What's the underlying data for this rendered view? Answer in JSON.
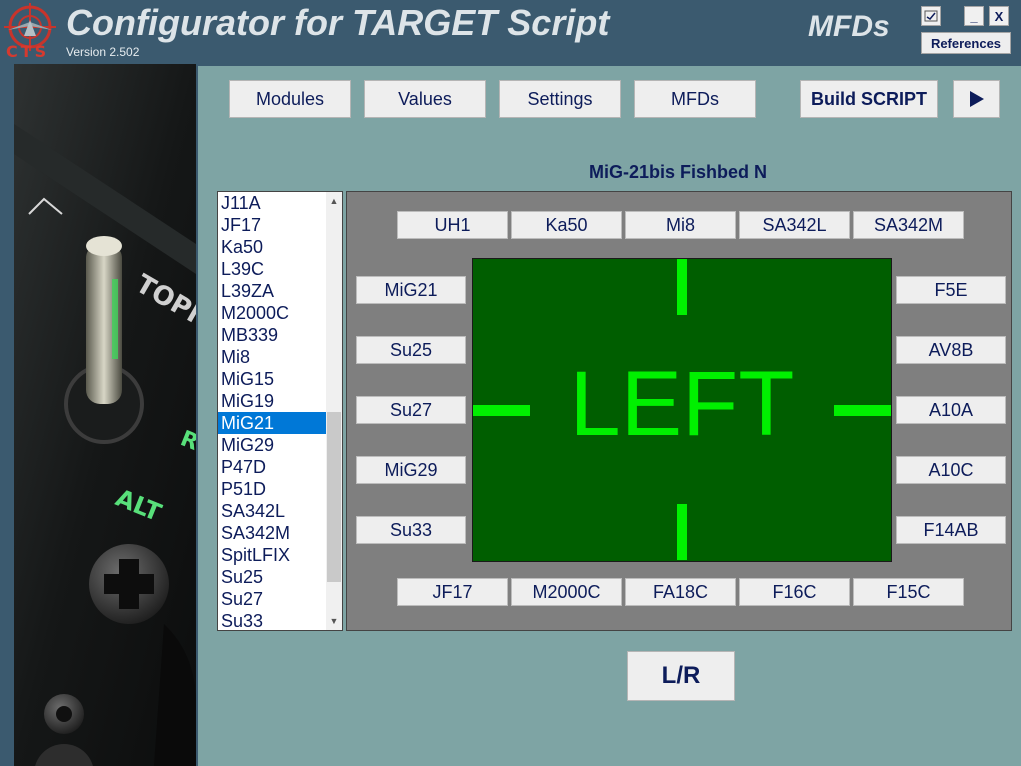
{
  "app": {
    "logo_text": "CTS",
    "title": "Configurator for TARGET Script",
    "version": "Version 2.502",
    "section": "MFDs"
  },
  "window_controls": {
    "minimize_label": "_",
    "close_label": "X",
    "references_label": "References"
  },
  "nav": {
    "modules": "Modules",
    "values": "Values",
    "settings": "Settings",
    "mfds": "MFDs",
    "build": "Build SCRIPT",
    "run_icon": "play-icon"
  },
  "aircraft_title": "MiG-21bis Fishbed N",
  "aircraft_list": {
    "items": [
      "J11A",
      "JF17",
      "Ka50",
      "L39C",
      "L39ZA",
      "M2000C",
      "MB339",
      "Mi8",
      "MiG15",
      "MiG19",
      "MiG21",
      "MiG29",
      "P47D",
      "P51D",
      "SA342L",
      "SA342M",
      "SpitLFIX",
      "Su25",
      "Su27",
      "Su33"
    ],
    "selected": "MiG21"
  },
  "mfd": {
    "top": [
      "UH1",
      "Ka50",
      "Mi8",
      "SA342L",
      "SA342M"
    ],
    "left": [
      "MiG21",
      "Su25",
      "Su27",
      "MiG29",
      "Su33"
    ],
    "right": [
      "F5E",
      "AV8B",
      "A10A",
      "A10C",
      "F14AB"
    ],
    "bottom": [
      "JF17",
      "M2000C",
      "FA18C",
      "F16C",
      "F15C"
    ],
    "screen_label": "LEFT"
  },
  "lr_button": "L/R",
  "colors": {
    "title_bar": "#3b5a6f",
    "background": "#7ea4a4",
    "mfd_screen": "#005e00",
    "mfd_text": "#00f000",
    "selection": "#0078d7",
    "label_text": "#0d1c5a"
  }
}
